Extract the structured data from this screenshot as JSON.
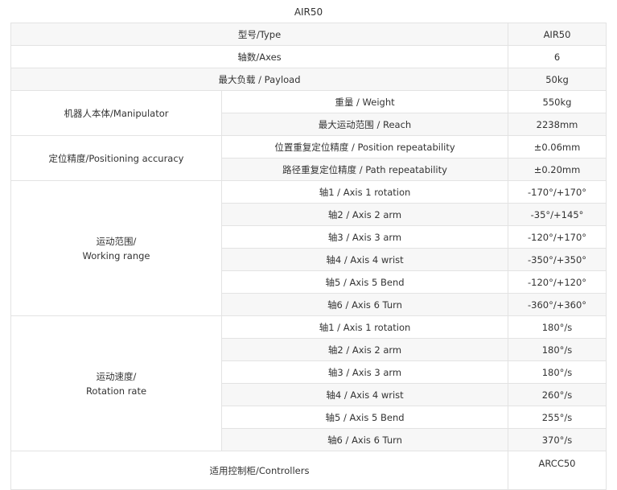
{
  "title": "AIR50",
  "rows": {
    "type": {
      "label": "型号/Type",
      "value": "AIR50"
    },
    "axes": {
      "label": "轴数/Axes",
      "value": "6"
    },
    "payload": {
      "label": "最大负载 / Payload",
      "value": "50kg"
    },
    "manipulator": {
      "group": "机器人本体/Manipulator",
      "weight": {
        "label": "重量 / Weight",
        "value": "550kg"
      },
      "reach": {
        "label": "最大运动范围 / Reach",
        "value": "2238mm"
      }
    },
    "accuracy": {
      "group": "定位精度/Positioning accuracy",
      "position": {
        "label": "位置重复定位精度 / Position repeatability",
        "value": "±0.06mm"
      },
      "path": {
        "label": "路径重复定位精度 / Path repeatability",
        "value": "±0.20mm"
      }
    },
    "working_range": {
      "group_line1": "运动范围/",
      "group_line2": "Working range",
      "items": [
        {
          "label": "轴1 / Axis 1 rotation",
          "value": "-170°/+170°"
        },
        {
          "label": "轴2 / Axis 2 arm",
          "value": "-35°/+145°"
        },
        {
          "label": "轴3 / Axis 3 arm",
          "value": "-120°/+170°"
        },
        {
          "label": "轴4 / Axis 4 wrist",
          "value": "-350°/+350°"
        },
        {
          "label": "轴5 / Axis 5 Bend",
          "value": "-120°/+120°"
        },
        {
          "label": "轴6 / Axis 6 Turn",
          "value": "-360°/+360°"
        }
      ]
    },
    "rotation_rate": {
      "group_line1": "运动速度/",
      "group_line2": "Rotation rate",
      "items": [
        {
          "label": "轴1 / Axis 1 rotation",
          "value": "180°/s"
        },
        {
          "label": "轴2 / Axis 2 arm",
          "value": "180°/s"
        },
        {
          "label": "轴3 / Axis 3 arm",
          "value": "180°/s"
        },
        {
          "label": "轴4 / Axis 4 wrist",
          "value": "260°/s"
        },
        {
          "label": "轴5 / Axis 5 Bend",
          "value": "255°/s"
        },
        {
          "label": "轴6 / Axis 6 Turn",
          "value": "370°/s"
        }
      ]
    },
    "controllers": {
      "label": "适用控制柜/Controllers",
      "value": "ARCC50"
    }
  }
}
